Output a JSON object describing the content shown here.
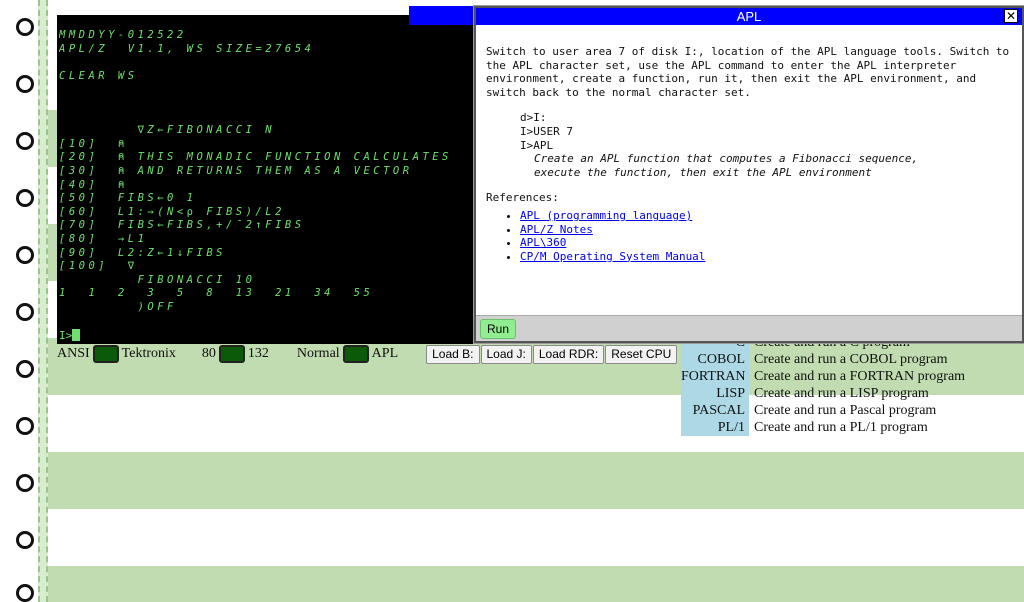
{
  "terminal": {
    "lines": [
      {
        "text": "MMDDYY-012522",
        "plain": false
      },
      {
        "text": "APL/Z  V1.1, WS SIZE=27654",
        "plain": false
      },
      {
        "text": "",
        "plain": false
      },
      {
        "text": "CLEAR WS",
        "plain": false
      },
      {
        "text": "",
        "plain": false
      },
      {
        "text": "",
        "plain": false
      },
      {
        "text": "",
        "plain": false
      },
      {
        "text": "        ∇Z←FIBONACCI N",
        "plain": false
      },
      {
        "text": "[10]  ⍝",
        "plain": false
      },
      {
        "text": "[20]  ⍝ THIS MONADIC FUNCTION CALCULATES",
        "plain": false
      },
      {
        "text": "[30]  ⍝ AND RETURNS THEM AS A VECTOR",
        "plain": false
      },
      {
        "text": "[40]  ⍝",
        "plain": false
      },
      {
        "text": "[50]  FIBS←0 1",
        "plain": false
      },
      {
        "text": "[60]  L1:→(N<⍴ FIBS)/L2",
        "plain": false
      },
      {
        "text": "[70]  FIBS←FIBS,+/¯2↑FIBS",
        "plain": false
      },
      {
        "text": "[80]  →L1",
        "plain": false
      },
      {
        "text": "[90]  L2:Z←1↓FIBS",
        "plain": false
      },
      {
        "text": "[100]  ∇",
        "plain": false
      },
      {
        "text": "        FIBONACCI 10",
        "plain": false
      },
      {
        "text": "1  1  2  3  5  8  13  21  34  55",
        "plain": false
      },
      {
        "text": "        )OFF",
        "plain": false
      }
    ],
    "prompt": "I>"
  },
  "controls": {
    "ansi": "ANSI",
    "tektronix": "Tektronix",
    "cols80": "80",
    "cols132": "132",
    "normal": "Normal",
    "apl": "APL",
    "load_b": "Load B:",
    "load_j": "Load J:",
    "load_rdr": "Load RDR:",
    "reset_cpu": "Reset CPU"
  },
  "languages": [
    {
      "name": "C",
      "desc": "Create and run a C program"
    },
    {
      "name": "COBOL",
      "desc": "Create and run a COBOL program"
    },
    {
      "name": "FORTRAN",
      "desc": "Create and run a FORTRAN program"
    },
    {
      "name": "LISP",
      "desc": "Create and run a LISP program"
    },
    {
      "name": "PASCAL",
      "desc": "Create and run a Pascal program"
    },
    {
      "name": "PL/1",
      "desc": "Create and run a PL/1 program"
    }
  ],
  "dialog": {
    "title": "APL",
    "close_glyph": "✕",
    "description": "Switch to user area 7 of disk I:, location of the APL language tools. Switch to the APL character set, use the APL command to enter the APL interpreter environment, create a function, run it, then exit the APL environment, and switch back to the normal character set.",
    "commands": [
      "d>I:",
      "I>USER 7",
      "I>APL"
    ],
    "note_line1": "Create an APL function that computes a Fibonacci sequence,",
    "note_line2": "execute the function, then exit the APL environment",
    "references_title": "References:",
    "references": [
      "APL (programming language)",
      "APL/Z Notes",
      "APL\\360",
      "CP/M Operating System Manual"
    ],
    "run_label": "Run"
  },
  "colors": {
    "terminal_text": "#6ee06e",
    "title_bar": "#0000ff",
    "greenbar": "#c0dcb0",
    "language_cell": "#add8e6",
    "run_button": "#90ee90"
  }
}
